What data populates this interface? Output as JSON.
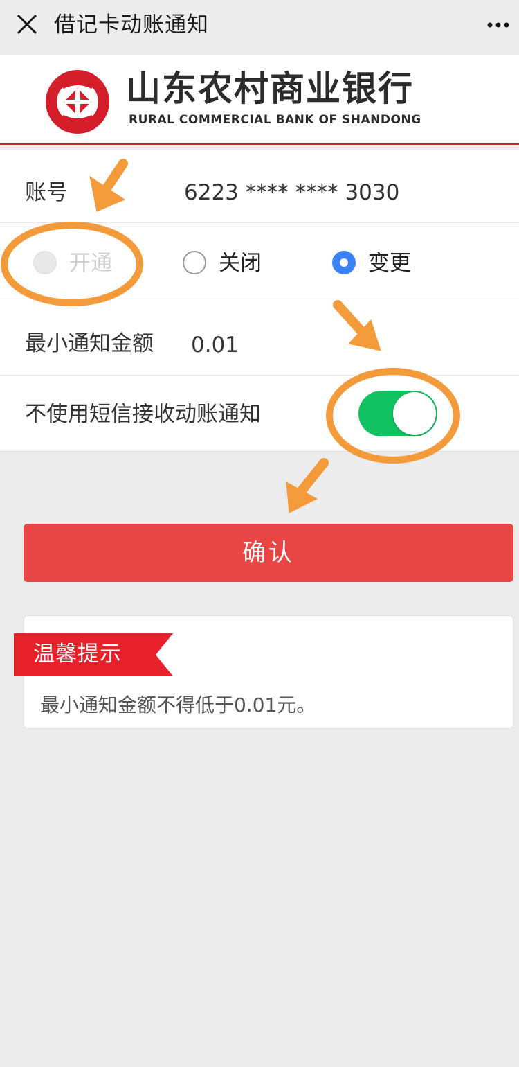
{
  "titlebar": {
    "title": "借记卡动账通知"
  },
  "bank": {
    "name_cn": "山东农村商业银行",
    "name_en": "RURAL COMMERCIAL  BANK  OF SHANDONG"
  },
  "form": {
    "account_label": "账号",
    "account_value": "6223 **** **** 3030",
    "radios": [
      {
        "label": "开通",
        "state": "disabled"
      },
      {
        "label": "关闭",
        "state": "unchecked"
      },
      {
        "label": "变更",
        "state": "checked"
      }
    ],
    "amount_label": "最小通知金额",
    "amount_value": "0.01",
    "sms_label": "不使用短信接收动账通知",
    "sms_toggle_on": true
  },
  "confirm_label": "确认",
  "tips": {
    "title": "温馨提示",
    "text": "最小通知金额不得低于0.01元。"
  },
  "colors": {
    "brand_red": "#d41e2b",
    "button_red": "#e84545",
    "toggle_green": "#10c260",
    "radio_blue": "#3b82f6",
    "annotation_orange": "#f39a3a"
  },
  "icons": {
    "close": "close-icon",
    "more": "more-icon",
    "logo": "bank-logo-icon"
  }
}
